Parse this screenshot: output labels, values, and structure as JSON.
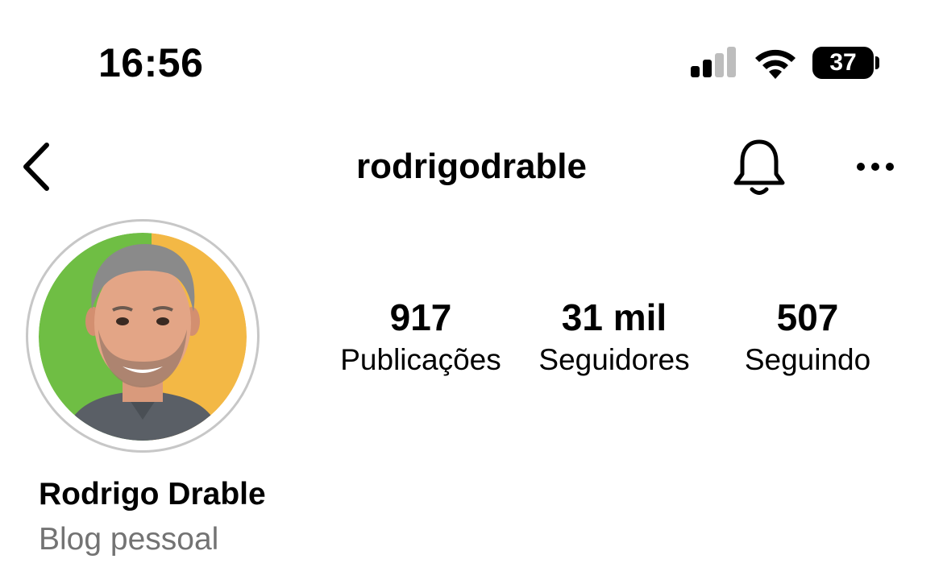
{
  "status_bar": {
    "time": "16:56",
    "battery": "37",
    "icons": [
      "signal-icon",
      "wifi-icon",
      "battery-icon"
    ]
  },
  "header": {
    "username": "rodrigodrable",
    "icons": [
      "chevron-left-icon",
      "bell-icon",
      "more-horizontal-icon"
    ]
  },
  "profile": {
    "avatar_colors": {
      "left": "#6fbe44",
      "right": "#f3b845",
      "ring": "#c7c7c7"
    },
    "stats": [
      {
        "value": "917",
        "label": "Publicações"
      },
      {
        "value": "31 mil",
        "label": "Seguidores"
      },
      {
        "value": "507",
        "label": "Seguindo"
      }
    ],
    "full_name": "Rodrigo Drable",
    "category": "Blog pessoal"
  }
}
